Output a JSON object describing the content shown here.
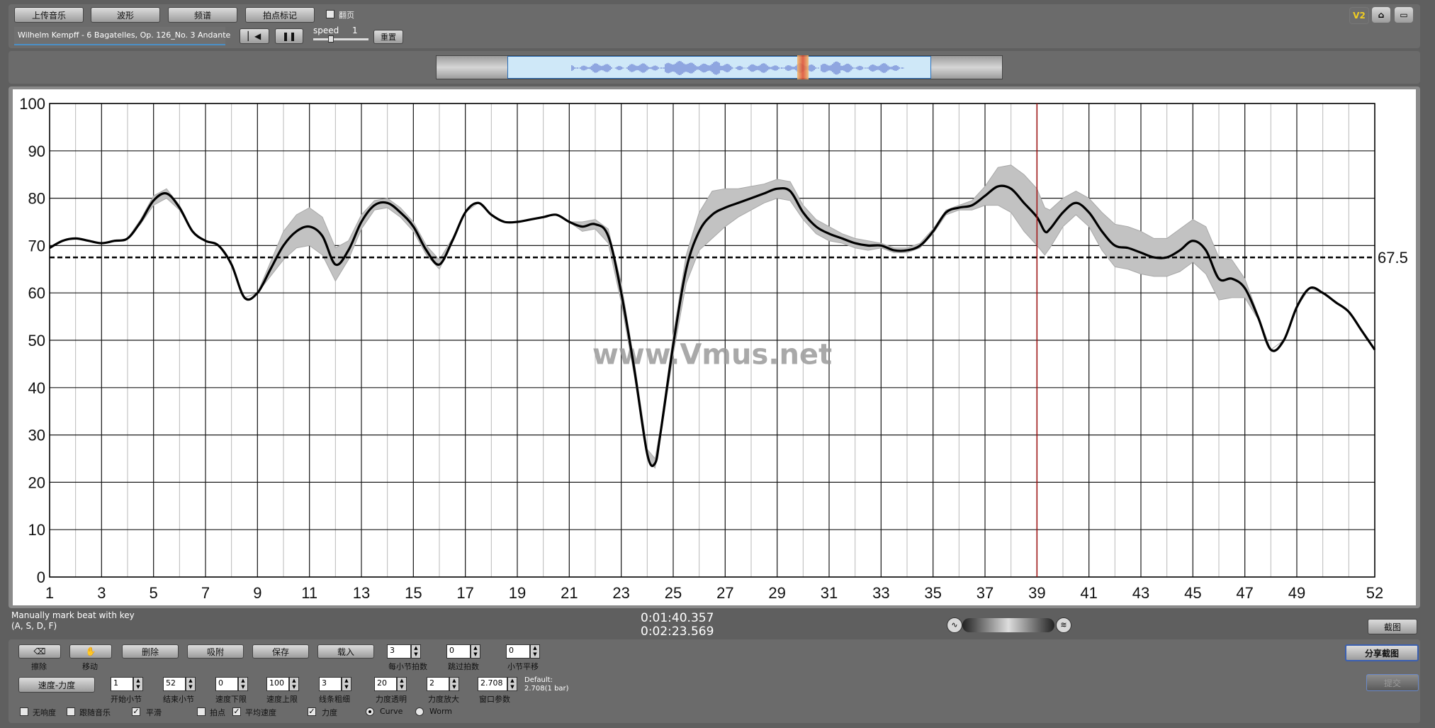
{
  "toolbar": {
    "upload_label": "上传音乐",
    "waveform_label": "波形",
    "spectrum_label": "频谱",
    "beat_mark_label": "拍点标记",
    "page_turn_label": "翻页",
    "track_title": "Wilhelm Kempff - 6 Bagatelles, Op. 126_No. 3 Andante",
    "speed_label": "speed",
    "speed_value": "1",
    "reset_label": "重置"
  },
  "top_right": {
    "version_badge": "V2"
  },
  "chart_data": {
    "type": "line",
    "title": "",
    "xlabel": "",
    "ylabel": "",
    "xlim": [
      1,
      52
    ],
    "ylim": [
      0,
      100
    ],
    "x_ticks": [
      "1",
      "3",
      "5",
      "7",
      "9",
      "11",
      "13",
      "15",
      "17",
      "19",
      "21",
      "23",
      "25",
      "27",
      "29",
      "31",
      "33",
      "35",
      "37",
      "39",
      "41",
      "43",
      "45",
      "47",
      "49",
      "52"
    ],
    "y_ticks": [
      "0",
      "10",
      "20",
      "30",
      "40",
      "50",
      "60",
      "70",
      "80",
      "90",
      "100"
    ],
    "average_line": {
      "value": 67.5,
      "label": "67.5"
    },
    "cursor_x": 39,
    "grid": true,
    "watermark": "www.Vmus.net",
    "series": [
      {
        "x": [
          1,
          1.5,
          2,
          2.5,
          3,
          3.5,
          4,
          4.5,
          5,
          5.5,
          6,
          6.5,
          7,
          7.5,
          8,
          8.5,
          9,
          9.5,
          10,
          10.5,
          11,
          11.5,
          12,
          12.5,
          13,
          13.5,
          14,
          14.5,
          15,
          15.5,
          16,
          16.5,
          17,
          17.5,
          18,
          18.5,
          19,
          19.5,
          20,
          20.5,
          21,
          21.5,
          22,
          22.5,
          23,
          23.5,
          24,
          24.3,
          24.5,
          25,
          25.5,
          26,
          26.5,
          27,
          27.5,
          28,
          28.5,
          29,
          29.5,
          30,
          30.5,
          31,
          31.5,
          32,
          32.5,
          33,
          33.5,
          34,
          34.5,
          35,
          35.5,
          36,
          36.5,
          37,
          37.5,
          38,
          38.5,
          39,
          39.3,
          39.5,
          40,
          40.5,
          41,
          41.5,
          42,
          42.5,
          43,
          43.5,
          44,
          44.5,
          45,
          45.5,
          46,
          46.5,
          47,
          47.5,
          48,
          48.5,
          49,
          49.5,
          50,
          50.5,
          51,
          51.5,
          52
        ],
        "values": [
          69.5,
          71,
          71.5,
          71,
          70.5,
          71,
          71.5,
          75,
          79.5,
          81,
          78,
          73,
          71,
          70,
          66,
          59,
          60,
          65,
          70,
          73,
          74,
          72,
          66,
          69,
          75,
          78.5,
          79,
          77,
          74,
          69,
          66,
          71,
          77,
          79,
          76.5,
          75,
          75,
          75.5,
          76,
          76.5,
          75,
          74,
          74.5,
          72,
          60,
          44,
          26,
          24,
          30,
          49,
          65,
          73,
          76.5,
          78,
          79,
          80,
          81,
          82,
          81.5,
          77,
          74,
          72.5,
          71.5,
          70.5,
          70,
          70,
          69,
          69,
          70,
          73,
          77,
          78,
          78.5,
          80.5,
          82.5,
          82,
          79,
          76,
          73,
          73.5,
          77,
          79,
          77,
          73,
          70,
          69.5,
          68.5,
          67.5,
          67.5,
          69,
          71,
          69,
          63,
          63,
          61,
          55,
          48,
          50,
          57,
          61,
          60,
          58,
          56,
          52,
          48
        ]
      }
    ],
    "confidence_band": {
      "upper_offset": [
        0,
        0,
        0,
        0,
        0,
        0,
        0,
        0.5,
        1,
        1,
        0.5,
        0,
        0,
        0,
        0,
        0,
        0,
        1.5,
        3,
        3.5,
        4,
        4,
        3.5,
        2,
        1.5,
        1,
        1,
        1,
        1,
        1,
        1,
        0.5,
        0,
        0,
        0,
        0,
        0,
        0,
        0,
        0,
        0,
        1,
        1,
        1.5,
        2,
        1.5,
        1,
        1,
        1,
        2,
        3,
        4,
        5,
        4,
        3,
        2.5,
        2,
        2,
        2,
        1.5,
        1.5,
        1.5,
        1,
        1,
        1,
        0.5,
        0.5,
        0.5,
        0.5,
        0.5,
        0.5,
        0.5,
        1,
        2,
        4,
        5,
        6,
        6,
        5,
        4,
        3,
        2.5,
        3,
        4,
        4.5,
        4.5,
        4.5,
        4,
        4,
        4.5,
        4.5,
        5,
        4.5,
        4,
        2,
        0.5,
        0,
        0,
        0,
        0,
        0,
        0,
        0
      ],
      "lower_offset": [
        0,
        0,
        0,
        0,
        0,
        0,
        0,
        0.5,
        1,
        1,
        0.5,
        0,
        0,
        0,
        0,
        0,
        0,
        1.5,
        3,
        3.5,
        4,
        4,
        3.5,
        2,
        1.5,
        1,
        1,
        1,
        1,
        1,
        1,
        0.5,
        0,
        0,
        0,
        0,
        0,
        0,
        0,
        0,
        0,
        1,
        1,
        1.5,
        2,
        1.5,
        1,
        1,
        1,
        2,
        3,
        4,
        5,
        4,
        3,
        2.5,
        2,
        2,
        2,
        1.5,
        1.5,
        1.5,
        1,
        1,
        1,
        0.5,
        0.5,
        0.5,
        0.5,
        0.5,
        0.5,
        0.5,
        1,
        2,
        4,
        5,
        6,
        6,
        5,
        4,
        3,
        2.5,
        3,
        4,
        4.5,
        4.5,
        4.5,
        4,
        4,
        4.5,
        4.5,
        5,
        4.5,
        4,
        2,
        0.5,
        0,
        0,
        0,
        0,
        0,
        0,
        0
      ]
    }
  },
  "status": {
    "hint_line1": "Manually mark beat with key",
    "hint_line2": "(A, S, D, F)",
    "time_current": "0:01:40.357",
    "time_total": "0:02:23.569",
    "screenshot_label": "截图"
  },
  "controls": {
    "erase_label": "擦除",
    "move_label": "移动",
    "delete_label": "删除",
    "snap_label": "吸附",
    "save_label": "保存",
    "load_label": "载入",
    "beats_per_bar": {
      "value": "3",
      "label": "每小节拍数"
    },
    "skip_beats": {
      "value": "0",
      "label": "跳过拍数"
    },
    "bar_offset": {
      "value": "0",
      "label": "小节平移"
    },
    "share_label": "分享截图",
    "mode_label": "速度-力度",
    "start_bar": {
      "value": "1",
      "label": "开始小节"
    },
    "end_bar": {
      "value": "52",
      "label": "结束小节"
    },
    "tempo_min": {
      "value": "0",
      "label": "速度下限"
    },
    "tempo_max": {
      "value": "100",
      "label": "速度上限"
    },
    "line_thickness": {
      "value": "3",
      "label": "线条粗细"
    },
    "dynamics_alpha": {
      "value": "20",
      "label": "力度透明"
    },
    "dynamics_scale": {
      "value": "2",
      "label": "力度放大"
    },
    "window_param": {
      "value": "2.708",
      "label": "窗口参数"
    },
    "default_line1": "Default:",
    "default_line2": "2.708(1 bar)",
    "disabled_label": "提交",
    "checks": {
      "no_sound": "无响度",
      "follow_music": "跟随音乐",
      "smooth": "平滑",
      "beat_points": "拍点",
      "avg_tempo": "平均速度",
      "dynamics": "力度",
      "curve": "Curve",
      "worm": "Worm"
    }
  },
  "colors": {
    "chart_line": "#000000",
    "band": "#c2c2c2",
    "cursor": "#a01010",
    "wave_bg": "#cde7f7",
    "wave": "#4f63c8",
    "badge": "#e8c210"
  }
}
